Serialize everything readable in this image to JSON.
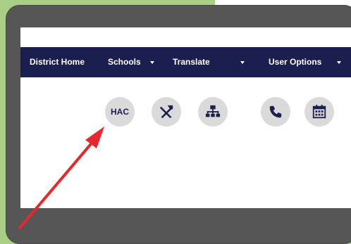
{
  "nav": {
    "items": [
      {
        "label": "District Home"
      },
      {
        "label": "Schools"
      },
      {
        "label": "Translate"
      },
      {
        "label": "User Options"
      }
    ]
  },
  "quick_links": [
    {
      "label": "HAC",
      "icon": "hac-text-icon"
    },
    {
      "icon": "utensils-icon"
    },
    {
      "icon": "sitemap-icon"
    },
    {
      "icon": "phone-icon"
    },
    {
      "icon": "calendar-icon"
    }
  ],
  "colors": {
    "nav_bg": "#1b1f4f",
    "icon_bg": "#dadada",
    "device_frame": "#565656",
    "background_green": "#a9cf86",
    "arrow_red": "#e8262b"
  }
}
